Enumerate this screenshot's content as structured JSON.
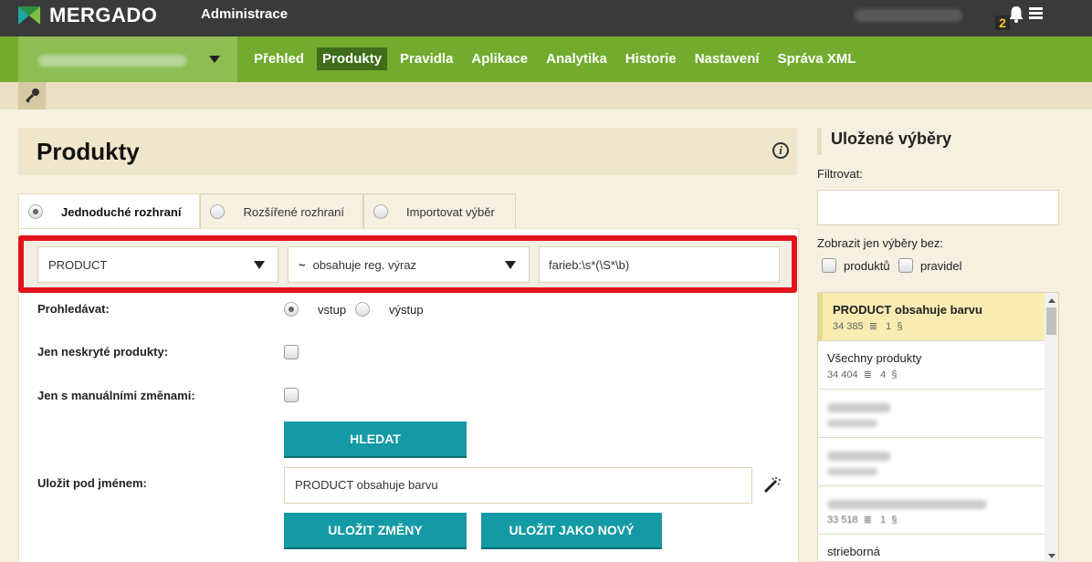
{
  "header": {
    "logo_text": "MERGADO",
    "admin_label": "Administrace",
    "notification_count": "2"
  },
  "nav": {
    "items": [
      {
        "label": "Přehled",
        "active": false
      },
      {
        "label": "Produkty",
        "active": true
      },
      {
        "label": "Pravidla",
        "active": false
      },
      {
        "label": "Aplikace",
        "active": false
      },
      {
        "label": "Analytika",
        "active": false
      },
      {
        "label": "Historie",
        "active": false
      },
      {
        "label": "Nastavení",
        "active": false
      },
      {
        "label": "Správa XML",
        "active": false
      }
    ]
  },
  "page": {
    "title": "Produkty"
  },
  "tabs": [
    {
      "label": "Jednoduché rozhraní",
      "active": true
    },
    {
      "label": "Rozšířené rozhraní",
      "active": false
    },
    {
      "label": "Importovat výběr",
      "active": false
    }
  ],
  "filter": {
    "field_value": "PRODUCT",
    "operator_symbol": "~",
    "operator_value": "obsahuje reg. výraz",
    "query_value": "farieb:\\s*(\\S*\\b)"
  },
  "form": {
    "search_in_label": "Prohledávat:",
    "search_in_options": [
      "vstup",
      "výstup"
    ],
    "search_in_selected": "vstup",
    "hidden_only_label": "Jen neskryté produkty:",
    "manual_only_label": "Jen s manuálními změnami:",
    "search_button": "HLEDAT",
    "save_name_label": "Uložit pod jménem:",
    "save_name_value": "PRODUCT obsahuje barvu",
    "save_changes_button": "ULOŽIT ZMĚNY",
    "save_new_button": "ULOŽIT JAKO NOVÝ"
  },
  "sidebar": {
    "title": "Uložené výběry",
    "filter_label": "Filtrovat:",
    "show_without_label": "Zobrazit jen výběry bez:",
    "checkbox_products": "produktů",
    "checkbox_rules": "pravidel",
    "saved": [
      {
        "name": "PRODUCT obsahuje barvu",
        "products": "34 385",
        "rules": "1",
        "active": true
      },
      {
        "name": "Všechny produkty",
        "products": "34 404",
        "rules": "4",
        "active": false
      },
      {
        "name": "",
        "products": "",
        "rules": "",
        "active": false
      },
      {
        "name": "",
        "products": "",
        "rules": "",
        "active": false
      },
      {
        "name": "",
        "products": "33 518",
        "rules": "1",
        "active": false
      },
      {
        "name": "strieborná",
        "products": "",
        "rules": "",
        "active": false
      }
    ]
  },
  "colors": {
    "topbar": "#3a3a3a",
    "nav_green": "#72ab2e",
    "button_teal": "#139aa5",
    "highlight_red": "#e1141b",
    "selected_item": "#f8ecb2"
  },
  "icons": [
    "mergado-logo-icon",
    "bell-icon",
    "menu-icon",
    "key-icon",
    "info-icon",
    "caret-down-icon",
    "magic-wand-icon"
  ]
}
